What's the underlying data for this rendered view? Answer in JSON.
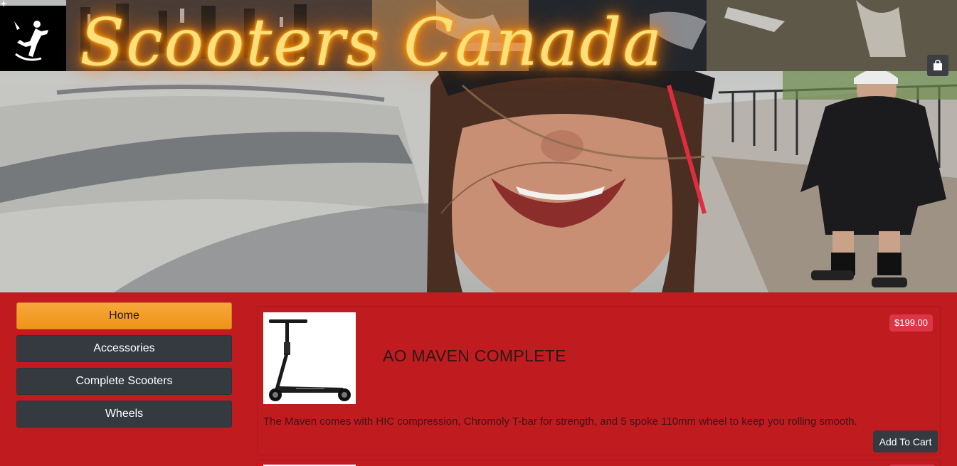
{
  "header": {
    "brand": "Scooters Canada",
    "logo_icon": "skater-icon",
    "cart_icon": "shopping-bag-icon"
  },
  "sidebar": {
    "items": [
      {
        "label": "Home",
        "active": true
      },
      {
        "label": "Accessories",
        "active": false
      },
      {
        "label": "Complete Scooters",
        "active": false
      },
      {
        "label": "Wheels",
        "active": false
      }
    ]
  },
  "products": [
    {
      "title": "AO MAVEN COMPLETE",
      "price": "$199.00",
      "description": "The Maven comes with HIC compression, Chromoly T-bar for strength, and 5 spoke 110mm wheel to keep you rolling smooth.",
      "button_label": "Add To Cart"
    }
  ],
  "colors": {
    "page_bg": "#c01c20",
    "active_nav": "#f0a030",
    "nav_bg": "#343a40",
    "price_badge": "#dc3545",
    "neon_text": "#ffdf7a"
  }
}
